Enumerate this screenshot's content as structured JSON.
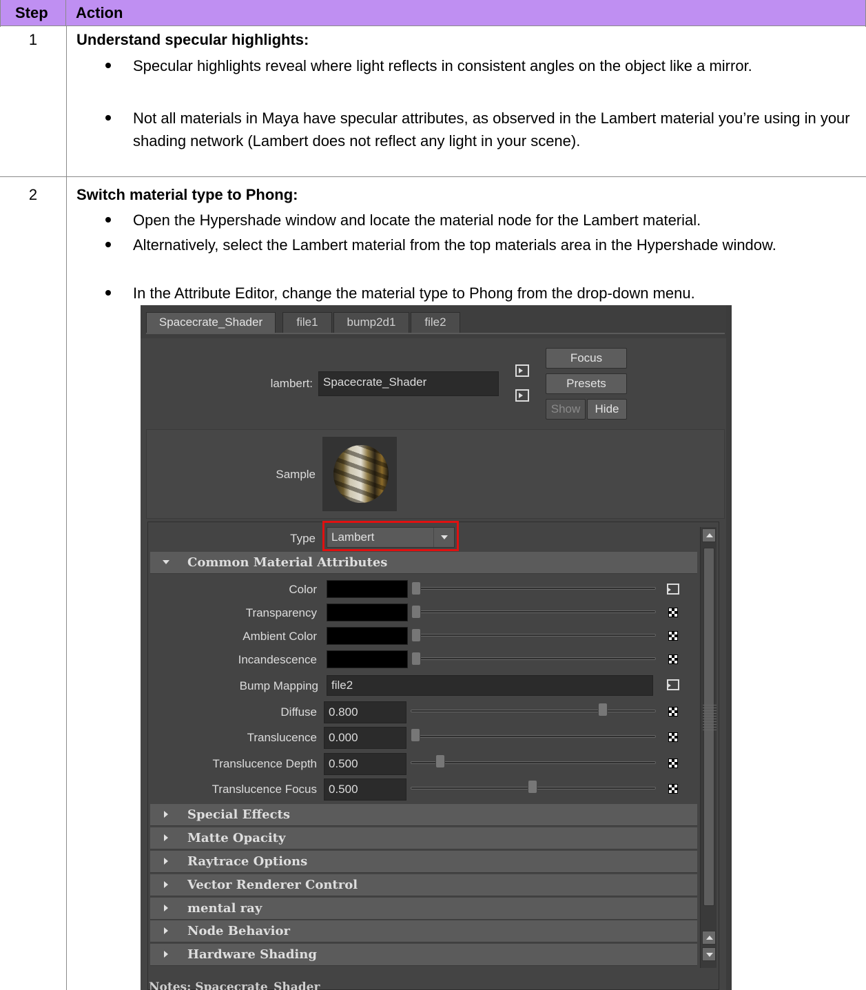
{
  "table": {
    "header_step": "Step",
    "header_action": "Action",
    "rows": [
      {
        "step": "1",
        "heading": "Understand specular highlights:",
        "bullets": [
          "Specular highlights reveal where light reflects in consistent angles on the object like a mirror.",
          "Not all materials in Maya have specular attributes, as observed in the Lambert material you’re using in your shading network (Lambert does not reflect any light in your scene)."
        ]
      },
      {
        "step": "2",
        "heading": "Switch material type to Phong:",
        "bullets": [
          "Open the Hypershade window and locate the material node for the Lambert material.",
          "Alternatively, select the Lambert material from the top materials area in the Hypershade window.",
          "In the Attribute Editor, change the material type to Phong from the drop-down menu."
        ]
      }
    ]
  },
  "attribute_editor": {
    "tabs": [
      "Spacecrate_Shader",
      "file1",
      "bump2d1",
      "file2"
    ],
    "node_type_label": "lambert:",
    "node_name": "Spacecrate_Shader",
    "buttons": {
      "focus": "Focus",
      "presets": "Presets",
      "show": "Show",
      "hide": "Hide"
    },
    "sample_label": "Sample",
    "type_label": "Type",
    "type_value": "Lambert",
    "common_section": "Common Material Attributes",
    "attrs": {
      "color": "Color",
      "transparency": "Transparency",
      "ambient": "Ambient Color",
      "incandescence": "Incandescence",
      "bump": "Bump Mapping",
      "bump_value": "file2",
      "diffuse": "Diffuse",
      "diffuse_value": "0.800",
      "translucence": "Translucence",
      "translucence_value": "0.000",
      "trans_depth": "Translucence Depth",
      "trans_depth_value": "0.500",
      "trans_focus": "Translucence Focus",
      "trans_focus_value": "0.500"
    },
    "sections": [
      "Special Effects",
      "Matte Opacity",
      "Raytrace Options",
      "Vector Renderer Control",
      "mental ray",
      "Node Behavior",
      "Hardware Shading"
    ],
    "notes": "Notes: Spacecrate_Shader",
    "highlight_color": "#e01010"
  }
}
